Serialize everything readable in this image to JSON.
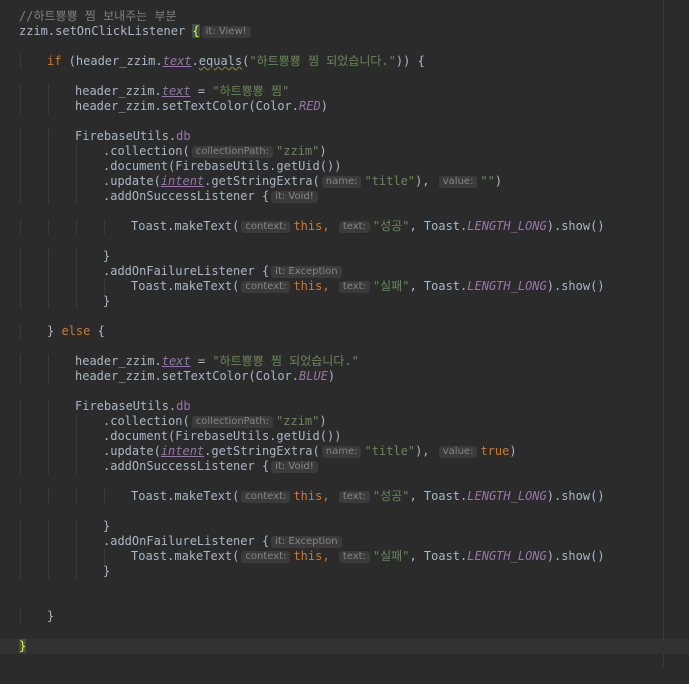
{
  "hints": {
    "it_view": "it: View!",
    "it_void": "it: Void!",
    "it_exception": "it: Exception",
    "collection_path": "collectionPath:",
    "name": "name:",
    "value": "value:",
    "context": "context:",
    "text": "text:"
  },
  "code": {
    "comment": "//하트뿅뿅 찜 보내주는 부분",
    "zzim_listener": "zzim.setOnClickListener",
    "kw_if": "if",
    "kw_else": "else",
    "kw_this": "this",
    "kw_true": "true",
    "header_zzim": "header_zzim",
    "text_prop": "text",
    "equals": "equals",
    "set_text_color": "setTextColor",
    "color_prefix": "Color.",
    "color_red": "RED",
    "color_blue": "BLUE",
    "str_zzim_done": "\"하트뿅뿅 찜 되었습니다.\"",
    "str_zzim": "\"하트뿅뿅 찜\"",
    "firebase_utils": "FirebaseUtils",
    "db": "db",
    "collection_call": ".collection(",
    "str_collection": "\"zzim\"",
    "document_call": ".document(FirebaseUtils.getUid())",
    "update_call": ".update(",
    "intent": "intent",
    "get_string_extra": ".getStringExtra(",
    "str_title": "\"title\"",
    "str_empty": "\"\"",
    "add_success": ".addOnSuccessListener",
    "add_failure": ".addOnFailureListener",
    "toast_make_text": "Toast.makeText(",
    "str_success": "\"성공\"",
    "str_fail": "\"실패\"",
    "toast_prefix": "Toast.",
    "length_long": "LENGTH_LONG",
    "show_call": ").show()"
  }
}
